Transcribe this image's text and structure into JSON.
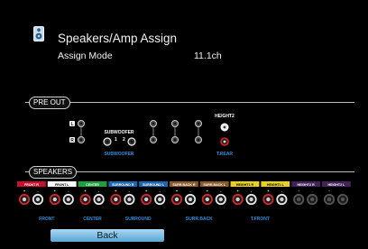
{
  "header": {
    "title": "Speakers/Amp Assign",
    "icon": "speaker-icon"
  },
  "assign_mode": {
    "label": "Assign Mode",
    "value": "11.1ch"
  },
  "pre_out": {
    "label": "PRE OUT",
    "rows": [
      "L",
      "R"
    ],
    "subwoofer_label": "SUBWOOFER",
    "subwoofer_channels": [
      "1",
      "2"
    ],
    "subwoofer_bottom_label": "SUBWOOFER",
    "height2_label": "HEIGHT2",
    "trear_label": "T.REAR"
  },
  "speakers": {
    "label": "SPEAKERS",
    "headers": [
      {
        "label": "FRONT R",
        "color": "#c8102e"
      },
      {
        "label": "FRONT L",
        "color": "#ffffff"
      },
      {
        "label": "CENTER",
        "color": "#1f9e3c"
      },
      {
        "label": "SURROUND R",
        "color": "#1b67b4"
      },
      {
        "label": "SURROUND L",
        "color": "#1b67b4"
      },
      {
        "label": "SURR.BACK R",
        "color": "#8a5a2b"
      },
      {
        "label": "SURR.BACK L",
        "color": "#8a5a2b"
      },
      {
        "label": "HEIGHT1 R",
        "color": "#e8d21d"
      },
      {
        "label": "HEIGHT1 L",
        "color": "#e8d21d"
      },
      {
        "label": "HEIGHT2 R",
        "color": "#7b3fa6"
      },
      {
        "label": "HEIGHT2 L",
        "color": "#7b3fa6"
      }
    ],
    "group_labels": [
      "FRONT",
      "CENTER",
      "SURROUND",
      "SURR.BACK",
      "T.FRONT"
    ]
  },
  "buttons": {
    "back": "Back"
  },
  "colors": {
    "accent_blue": "#2f8fdc",
    "back_button": "#78b8e0"
  }
}
